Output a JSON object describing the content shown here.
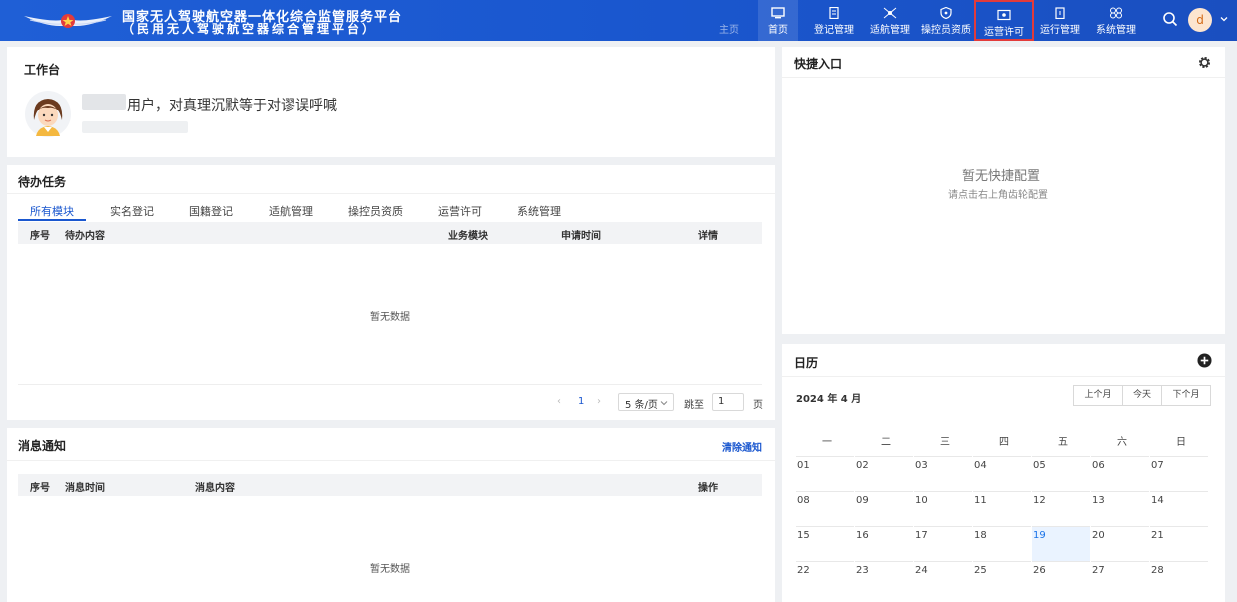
{
  "header": {
    "title": "国家无人驾驶航空器一体化综合监管服务平台",
    "subtitle": "（民用无人驾驶航空器综合管理平台）",
    "user_initial": "d",
    "nav": [
      {
        "label": "主页"
      },
      {
        "label": "首页"
      },
      {
        "label": "登记管理"
      },
      {
        "label": "适航管理"
      },
      {
        "label": "操控员资质"
      },
      {
        "label": "运营许可"
      },
      {
        "label": "运行管理"
      },
      {
        "label": "系统管理"
      }
    ]
  },
  "workbench": {
    "title": "工作台",
    "greeting": "用户，对真理沉默等于对谬误呼喊"
  },
  "todo": {
    "title": "待办任务",
    "tabs": [
      "所有模块",
      "实名登记",
      "国籍登记",
      "适航管理",
      "操控员资质",
      "运营许可",
      "系统管理"
    ],
    "columns": [
      "序号",
      "待办内容",
      "业务模块",
      "申请时间",
      "详情"
    ],
    "empty": "暂无数据",
    "pagination": {
      "prev": "‹",
      "page": "1",
      "next": "›",
      "page_size": "5 条/页",
      "jump_label": "跳至",
      "jump_value": "1",
      "page_unit": "页"
    }
  },
  "notice": {
    "title": "消息通知",
    "clear": "清除通知",
    "columns": [
      "序号",
      "消息时间",
      "消息内容",
      "操作"
    ],
    "empty": "暂无数据"
  },
  "shortcut": {
    "title": "快捷入口",
    "empty_title": "暂无快捷配置",
    "empty_hint": "请点击右上角齿轮配置"
  },
  "calendar": {
    "title": "日历",
    "month": "2024 年 4 月",
    "buttons": [
      "上个月",
      "今天",
      "下个月"
    ],
    "weekdays": [
      "一",
      "二",
      "三",
      "四",
      "五",
      "六",
      "日"
    ],
    "weeks": [
      [
        "01",
        "02",
        "03",
        "04",
        "05",
        "06",
        "07"
      ],
      [
        "08",
        "09",
        "10",
        "11",
        "12",
        "13",
        "14"
      ],
      [
        "15",
        "16",
        "17",
        "18",
        "19",
        "20",
        "21"
      ],
      [
        "22",
        "23",
        "24",
        "25",
        "26",
        "27",
        "28"
      ]
    ],
    "today": "19",
    "today_color": "#1a73e8"
  },
  "colors": {
    "brand": "#1a57cf",
    "highlight_box": "#e23b3b"
  }
}
